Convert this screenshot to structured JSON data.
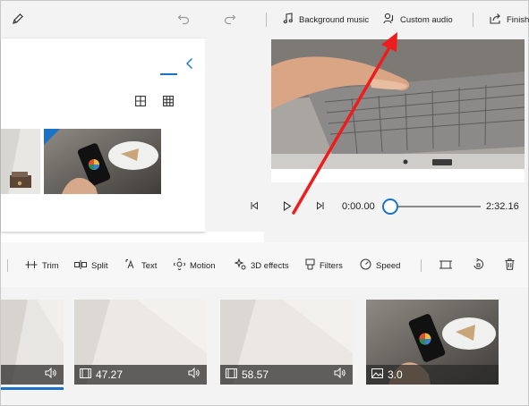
{
  "toolbar": {
    "background_music": "Background music",
    "custom_audio": "Custom audio",
    "finish": "Finish"
  },
  "preview": {
    "current_time": "0:00.00",
    "total_time": "2:32.16",
    "progress_fraction": 0.0
  },
  "storyboard_toolbar": {
    "trim": "Trim",
    "split": "Split",
    "text": "Text",
    "motion": "Motion",
    "effects_3d": "3D effects",
    "filters": "Filters",
    "speed": "Speed"
  },
  "storyboard_cards": [
    {
      "duration": ""
    },
    {
      "duration": "47.27"
    },
    {
      "duration": "58.57"
    },
    {
      "duration": "3.0"
    }
  ],
  "colors": {
    "accent": "#1a73c8",
    "annotation_arrow": "#ee1c1c"
  }
}
